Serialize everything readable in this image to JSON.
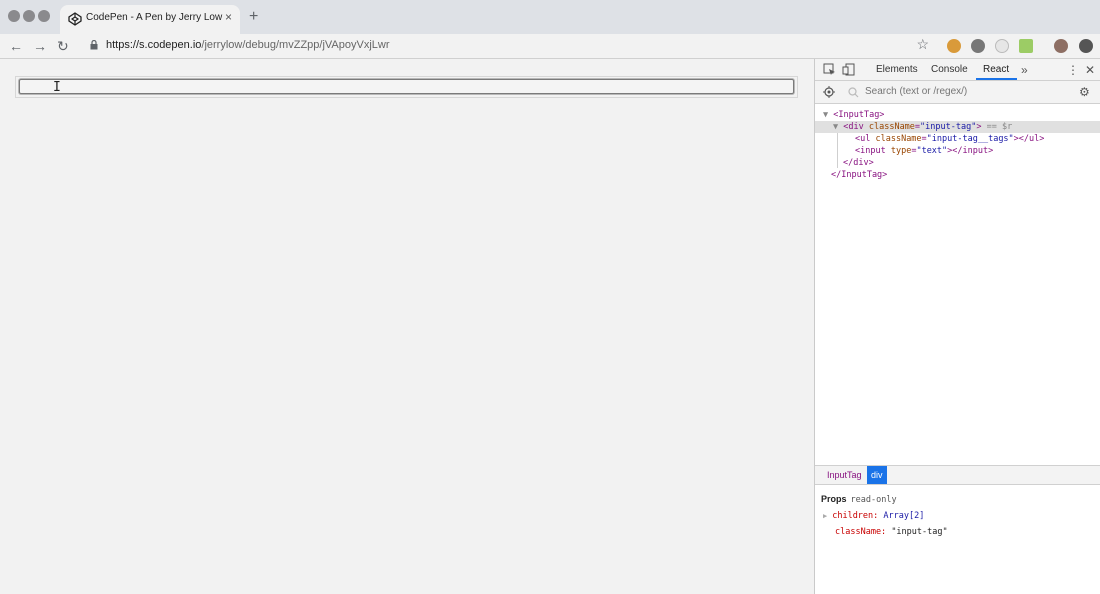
{
  "browser": {
    "tab_title": "CodePen - A Pen by Jerry Low",
    "tab_close": "×",
    "new_tab": "+",
    "url_host": "https://s.codepen.io",
    "url_path": "/jerrylow/debug/mvZZpp/jVApoyVxjLwr",
    "back": "←",
    "forward": "→",
    "reload": "↻",
    "bookmark": "☆",
    "traffic_light_color": "#8a8a8d"
  },
  "page": {
    "cursor": "I"
  },
  "devtools": {
    "tabs": [
      "Elements",
      "Console",
      "React"
    ],
    "active_tab": "React",
    "more": "»",
    "menu": "⋮",
    "close": "✕",
    "search_placeholder": "Search (text or /regex/)",
    "settings": "⚙",
    "tree": {
      "root_open": "<InputTag>",
      "div_open_tag": "<div",
      "div_attr": "className",
      "div_val": "\"input-tag\"",
      "div_close_bracket": ">",
      "div_selected_marker": "== $r",
      "ul_open_tag": "<ul",
      "ul_attr": "className",
      "ul_val": "\"input-tag__tags\"",
      "ul_close": "></ul>",
      "input_open_tag": "<input",
      "input_attr": "type",
      "input_val": "\"text\"",
      "input_close": "></input>",
      "div_close": "</div>",
      "root_close": "</InputTag>",
      "arrow_open": "▼"
    },
    "breadcrumbs": [
      {
        "label": "InputTag",
        "active": false
      },
      {
        "label": "div",
        "active": true
      }
    ],
    "props": {
      "title": "Props",
      "readonly": "read-only",
      "children_key": "children:",
      "children_val": "Array[2]",
      "classname_key": "className:",
      "classname_val": "\"input-tag\"",
      "expand_arrow": "▶"
    },
    "accent": "#1a73e8"
  }
}
